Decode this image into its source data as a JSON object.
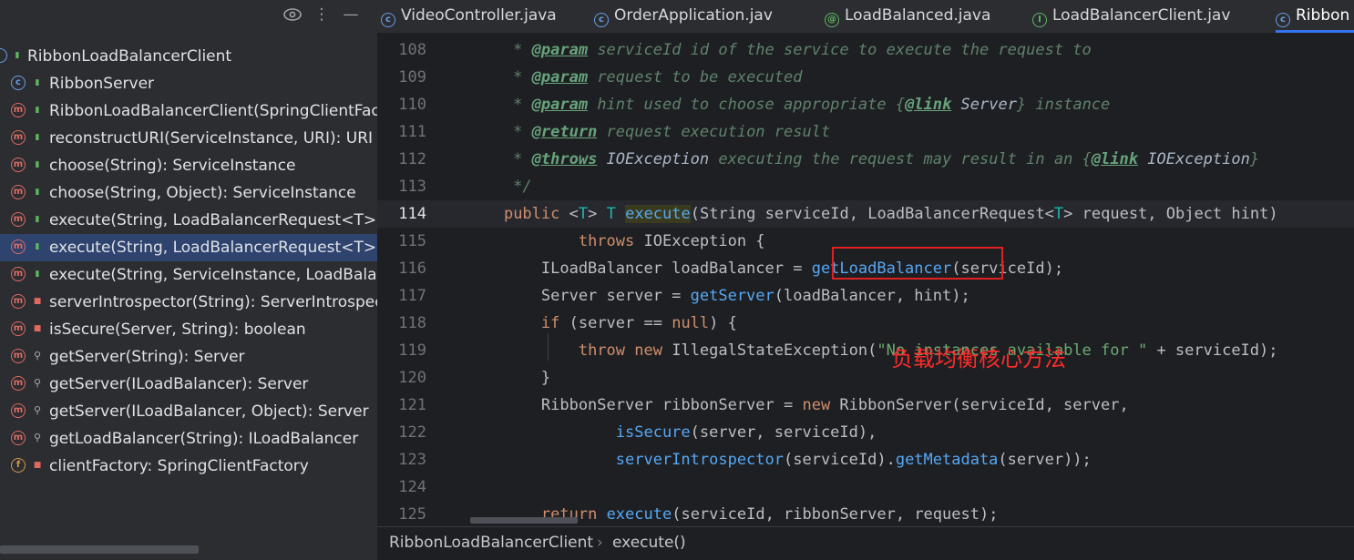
{
  "structure": {
    "toolbar": {
      "eye_icon": "eye-icon",
      "more_icon": "more-vertical-icon",
      "minimize_icon": "minimize-icon"
    },
    "items": [
      {
        "label": "RibbonLoadBalancerClient",
        "kind": "class-root",
        "visibility": "public"
      },
      {
        "label": "RibbonServer",
        "kind": "c",
        "visibility": "public"
      },
      {
        "label": "RibbonLoadBalancerClient(SpringClientFacto",
        "kind": "m",
        "visibility": "public"
      },
      {
        "label": "reconstructURI(ServiceInstance, URI): URI ↑Lo",
        "kind": "m",
        "visibility": "public"
      },
      {
        "label": "choose(String): ServiceInstance",
        "kind": "m",
        "visibility": "public"
      },
      {
        "label": "choose(String, Object): ServiceInstance",
        "kind": "m",
        "visibility": "public"
      },
      {
        "label": "execute(String, LoadBalancerRequest<T>): T",
        "kind": "m",
        "visibility": "public"
      },
      {
        "label": "execute(String, LoadBalancerRequest<T>, O",
        "kind": "m",
        "visibility": "public",
        "selected": true
      },
      {
        "label": "execute(String, ServiceInstance, LoadBalance",
        "kind": "m",
        "visibility": "public"
      },
      {
        "label": "serverIntrospector(String): ServerIntrospecto",
        "kind": "m",
        "visibility": "private"
      },
      {
        "label": "isSecure(Server, String): boolean",
        "kind": "m",
        "visibility": "private"
      },
      {
        "label": "getServer(String): Server",
        "kind": "m",
        "visibility": "package"
      },
      {
        "label": "getServer(ILoadBalancer): Server",
        "kind": "m",
        "visibility": "package"
      },
      {
        "label": "getServer(ILoadBalancer, Object): Server",
        "kind": "m",
        "visibility": "package"
      },
      {
        "label": "getLoadBalancer(String): ILoadBalancer",
        "kind": "m",
        "visibility": "package"
      },
      {
        "label": "clientFactory: SpringClientFactory",
        "kind": "f",
        "visibility": "private"
      }
    ]
  },
  "tabs": [
    {
      "label": "VideoController.java",
      "icon": "c",
      "color": "#6a9fe8"
    },
    {
      "label": "OrderApplication.jav",
      "icon": "c",
      "color": "#6a9fe8"
    },
    {
      "label": "LoadBalanced.java",
      "icon": "@",
      "color": "#5fb760"
    },
    {
      "label": "LoadBalancerClient.jav",
      "icon": "I",
      "color": "#5fb760"
    },
    {
      "label": "Ribbon",
      "icon": "c",
      "color": "#6a9fe8",
      "active": true
    }
  ],
  "code": {
    "lines": [
      {
        "n": "108",
        "text": "     * @param serviceId id of the service to execute the request to"
      },
      {
        "n": "109",
        "text": "     * @param request to be executed"
      },
      {
        "n": "110",
        "text": "     * @param hint used to choose appropriate {@link Server} instance"
      },
      {
        "n": "111",
        "text": "     * @return request execution result"
      },
      {
        "n": "112",
        "text": "     * @throws IOException executing the request may result in an {@link IOException}"
      },
      {
        "n": "113",
        "text": "     */"
      },
      {
        "n": "114",
        "text": "    public <T> T execute(String serviceId, LoadBalancerRequest<T> request, Object hint)"
      },
      {
        "n": "115",
        "text": "            throws IOException {"
      },
      {
        "n": "116",
        "text": "        ILoadBalancer loadBalancer = getLoadBalancer(serviceId);"
      },
      {
        "n": "117",
        "text": "        Server server = getServer(loadBalancer, hint);"
      },
      {
        "n": "118",
        "text": "        if (server == null) {"
      },
      {
        "n": "119",
        "text": "            throw new IllegalStateException(\"No instances available for \" + serviceId);"
      },
      {
        "n": "120",
        "text": "        }"
      },
      {
        "n": "121",
        "text": "        RibbonServer ribbonServer = new RibbonServer(serviceId, server,"
      },
      {
        "n": "122",
        "text": "                isSecure(server, serviceId),"
      },
      {
        "n": "123",
        "text": "                serverIntrospector(serviceId).getMetadata(server));"
      },
      {
        "n": "124",
        "text": ""
      },
      {
        "n": "125",
        "text": "        return execute(serviceId, ribbonServer, request);"
      }
    ],
    "current_line": "114",
    "annotation": "负载均衡核心方法"
  },
  "breadcrumb": {
    "class": "RibbonLoadBalancerClient",
    "separator": "›",
    "method": "execute()"
  }
}
